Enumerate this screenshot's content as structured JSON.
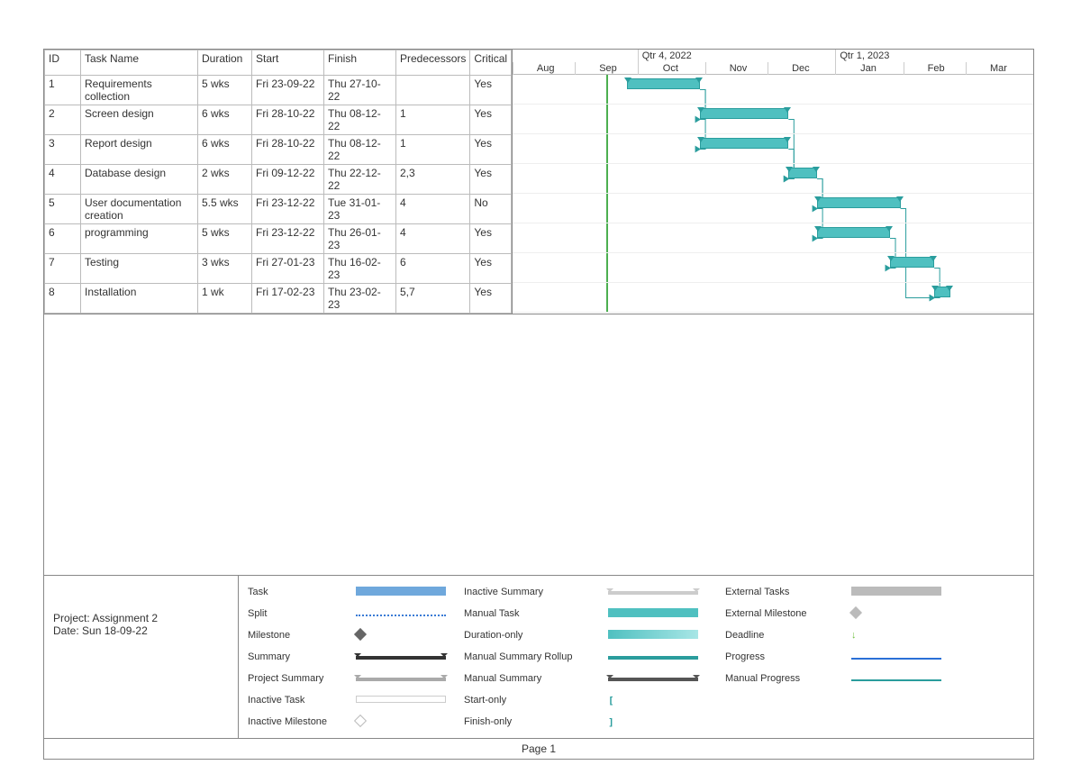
{
  "columns": {
    "id": "ID",
    "name": "Task Name",
    "duration": "Duration",
    "start": "Start",
    "finish": "Finish",
    "pred": "Predecessors",
    "critical": "Critical"
  },
  "tasks": [
    {
      "id": "1",
      "name": "Requirements collection",
      "duration": "5 wks",
      "start": "Fri 23-09-22",
      "finish": "Thu 27-10-22",
      "pred": "",
      "critical": "Yes"
    },
    {
      "id": "2",
      "name": "Screen design",
      "duration": "6 wks",
      "start": "Fri 28-10-22",
      "finish": "Thu 08-12-22",
      "pred": "1",
      "critical": "Yes"
    },
    {
      "id": "3",
      "name": "Report design",
      "duration": "6 wks",
      "start": "Fri 28-10-22",
      "finish": "Thu 08-12-22",
      "pred": "1",
      "critical": "Yes"
    },
    {
      "id": "4",
      "name": "Database design",
      "duration": "2 wks",
      "start": "Fri 09-12-22",
      "finish": "Thu 22-12-22",
      "pred": "2,3",
      "critical": "Yes"
    },
    {
      "id": "5",
      "name": "User documentation creation",
      "duration": "5.5 wks",
      "start": "Fri 23-12-22",
      "finish": "Tue 31-01-23",
      "pred": "4",
      "critical": "No"
    },
    {
      "id": "6",
      "name": "programming",
      "duration": "5 wks",
      "start": "Fri 23-12-22",
      "finish": "Thu 26-01-23",
      "pred": "4",
      "critical": "Yes"
    },
    {
      "id": "7",
      "name": "Testing",
      "duration": "3 wks",
      "start": "Fri 27-01-23",
      "finish": "Thu 16-02-23",
      "pred": "6",
      "critical": "Yes"
    },
    {
      "id": "8",
      "name": "Installation",
      "duration": "1 wk",
      "start": "Fri 17-02-23",
      "finish": "Thu 23-02-23",
      "pred": "5,7",
      "critical": "Yes"
    }
  ],
  "timeline": {
    "quarters": [
      {
        "label": "Qtr 4, 2022",
        "left_pct": 24,
        "width_pct": 38
      },
      {
        "label": "Qtr 1, 2023",
        "left_pct": 62,
        "width_pct": 38
      }
    ],
    "months": [
      {
        "label": "Aug",
        "left_pct": 0
      },
      {
        "label": "Sep",
        "left_pct": 12
      },
      {
        "label": "Oct",
        "left_pct": 24
      },
      {
        "label": "Nov",
        "left_pct": 37
      },
      {
        "label": "Dec",
        "left_pct": 49
      },
      {
        "label": "Jan",
        "left_pct": 62
      },
      {
        "label": "Feb",
        "left_pct": 75
      },
      {
        "label": "Mar",
        "left_pct": 87
      }
    ],
    "month_width_pct": 12.5,
    "today_left_pct": 18
  },
  "chart_data": {
    "type": "gantt",
    "x_axis": {
      "start": "2022-08-01",
      "end": "2023-03-31"
    },
    "bars": [
      {
        "row": 0,
        "left_pct": 22,
        "width_pct": 14,
        "task": 1
      },
      {
        "row": 1,
        "left_pct": 36,
        "width_pct": 17,
        "task": 2
      },
      {
        "row": 2,
        "left_pct": 36,
        "width_pct": 17,
        "task": 3
      },
      {
        "row": 3,
        "left_pct": 53,
        "width_pct": 5.5,
        "task": 4
      },
      {
        "row": 4,
        "left_pct": 58.5,
        "width_pct": 16,
        "task": 5
      },
      {
        "row": 5,
        "left_pct": 58.5,
        "width_pct": 14,
        "task": 6
      },
      {
        "row": 6,
        "left_pct": 72.5,
        "width_pct": 8.5,
        "task": 7
      },
      {
        "row": 7,
        "left_pct": 81,
        "width_pct": 3,
        "task": 8
      }
    ],
    "links": [
      {
        "from": 1,
        "to": 2
      },
      {
        "from": 1,
        "to": 3
      },
      {
        "from": 2,
        "to": 4
      },
      {
        "from": 3,
        "to": 4
      },
      {
        "from": 4,
        "to": 5
      },
      {
        "from": 4,
        "to": 6
      },
      {
        "from": 6,
        "to": 7
      },
      {
        "from": 5,
        "to": 8
      },
      {
        "from": 7,
        "to": 8
      }
    ]
  },
  "legend": {
    "project_label": "Project: Assignment 2",
    "date_label": "Date: Sun 18-09-22",
    "items": [
      [
        "Task",
        "sw-task"
      ],
      [
        "Split",
        "sw-split"
      ],
      [
        "Milestone",
        "sw-mile"
      ],
      [
        "Summary",
        "sw-summ"
      ],
      [
        "Project Summary",
        "sw-proj"
      ],
      [
        "Inactive Task",
        "sw-inact"
      ],
      [
        "Inactive Milestone",
        "sw-imile"
      ],
      [
        "Inactive Summary",
        "sw-isum"
      ],
      [
        "Manual Task",
        "sw-man"
      ],
      [
        "Duration-only",
        "sw-duronly"
      ],
      [
        "Manual Summary Rollup",
        "sw-msr"
      ],
      [
        "Manual Summary",
        "sw-msum"
      ],
      [
        "Start-only",
        "sw-start"
      ],
      [
        "Finish-only",
        "sw-finish"
      ],
      [
        "External Tasks",
        "sw-ext"
      ],
      [
        "External Milestone",
        "sw-emile"
      ],
      [
        "Deadline",
        "sw-dead"
      ],
      [
        "Progress",
        "sw-prog"
      ],
      [
        "Manual Progress",
        "sw-mprog"
      ]
    ]
  },
  "footer": "Page 1"
}
